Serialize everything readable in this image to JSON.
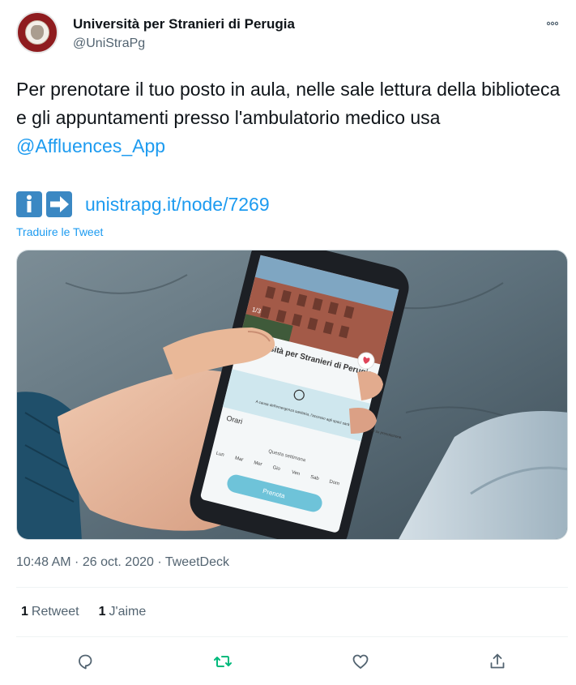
{
  "user": {
    "name": "Università per Stranieri di Perugia",
    "handle": "@UniStraPg"
  },
  "tweet": {
    "text_before_mention": "Per prenotare il tuo posto in aula, nelle sale lettura della biblioteca e gli appuntamenti presso l'ambulatorio medico usa ",
    "mention": "@Affluences_App",
    "link": "unistrapg.it/node/7269",
    "translate": "Traduire le Tweet"
  },
  "phone_screen": {
    "page_indicator": "1/3",
    "title": "Università per Stranieri di Perugia",
    "notice": "A causa dell'emergenza sanitaria, l'accesso agli spazi sarà consentito solo su prenotazione.",
    "section": "Orari",
    "week_label": "Questa settimana",
    "days": [
      "Lun",
      "Mar",
      "Mer",
      "Gio",
      "Ven",
      "Sab",
      "Dom"
    ],
    "button": "Prenota"
  },
  "meta": {
    "time": "10:48 AM",
    "date": "26 oct. 2020",
    "source": "TweetDeck",
    "separator": " · "
  },
  "stats": {
    "retweets_count": "1",
    "retweets_label": "Retweet",
    "likes_count": "1",
    "likes_label": "J'aime"
  },
  "colors": {
    "accent": "#1d9bf0",
    "retweet_green": "#00ba7c",
    "text": "#0f1419",
    "muted": "#536471",
    "avatar_bg": "#8f1c1f",
    "emoji_blue": "#3b88c3"
  },
  "icons": {
    "more": "more-icon",
    "info": "information-emoji-icon",
    "arrow": "right-arrow-emoji-icon",
    "reply": "reply-icon",
    "retweet": "retweet-icon",
    "like": "heart-icon",
    "share": "share-icon"
  }
}
